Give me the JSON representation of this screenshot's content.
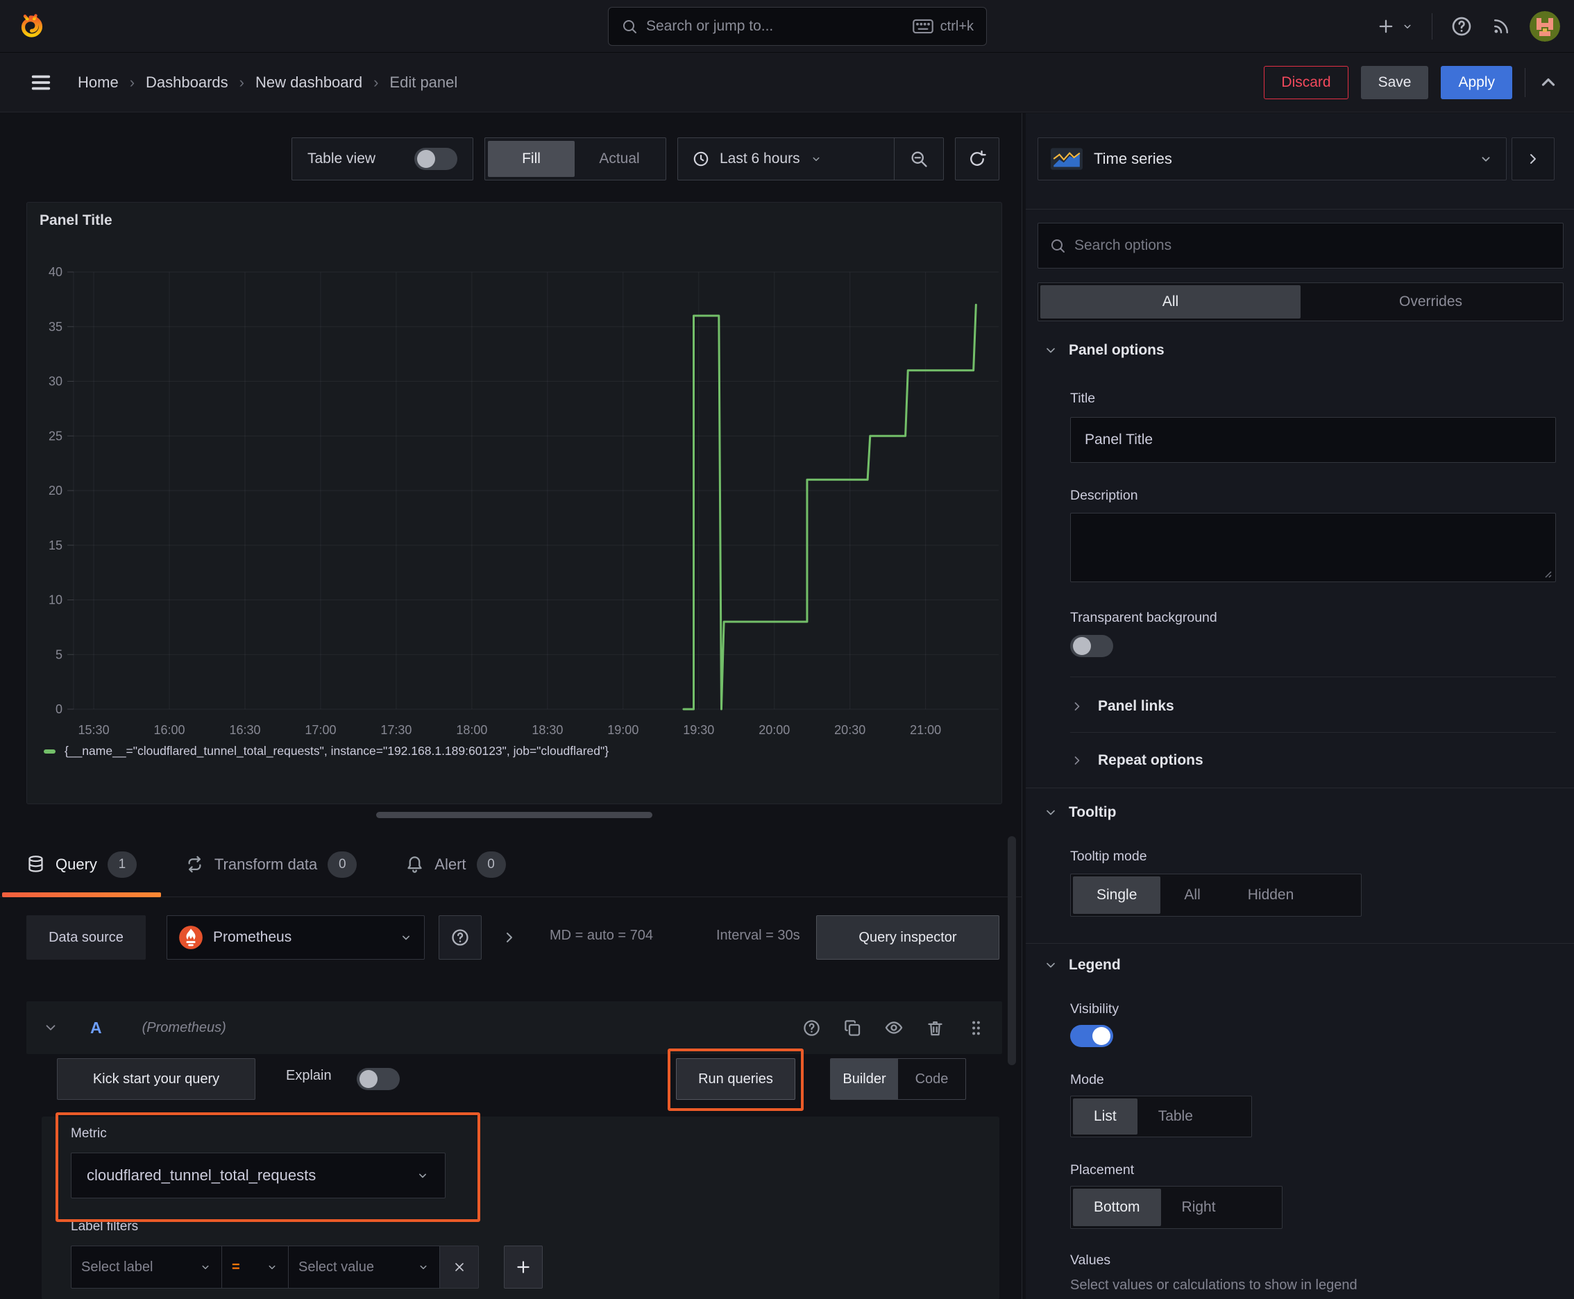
{
  "colors": {
    "background": "#111217",
    "panel_background": "#181b1f",
    "accent_orange": "#ff780a",
    "annotation_orange": "#eb5b28",
    "tab_underline_gradient": [
      "#f55f3e",
      "#ff8833"
    ],
    "series_green": "#73bf69",
    "primary_blue": "#3d71d9",
    "discard_red": "#f2495c",
    "ref_id_blue": "#6e9fff",
    "text": "#ccccdc"
  },
  "topbar": {
    "search_placeholder": "Search or jump to...",
    "search_shortcut": "ctrl+k"
  },
  "nav": {
    "breadcrumbs": [
      "Home",
      "Dashboards",
      "New dashboard",
      "Edit panel"
    ],
    "discard": "Discard",
    "save": "Save",
    "apply": "Apply"
  },
  "toolbar": {
    "table_view_label": "Table view",
    "fill": "Fill",
    "actual": "Actual",
    "time_range": "Last 6 hours"
  },
  "panel": {
    "title": "Panel Title",
    "legend_label": "{__name__=\"cloudflared_tunnel_total_requests\", instance=\"192.168.1.189:60123\", job=\"cloudflared\"}"
  },
  "chart_data": {
    "type": "line",
    "title": "Panel Title",
    "line_style": "stepped-counter",
    "series": [
      {
        "name": "{__name__=\"cloudflared_tunnel_total_requests\", instance=\"192.168.1.189:60123\", job=\"cloudflared\"}",
        "color": "#73bf69",
        "points": [
          [
            "19:24",
            0
          ],
          [
            "19:28",
            0
          ],
          [
            "19:28",
            36
          ],
          [
            "19:38",
            36
          ],
          [
            "19:39",
            0
          ],
          [
            "19:40",
            8
          ],
          [
            "20:13",
            8
          ],
          [
            "20:13",
            21
          ],
          [
            "20:37",
            21
          ],
          [
            "20:38",
            25
          ],
          [
            "20:52",
            25
          ],
          [
            "20:53",
            31
          ],
          [
            "21:19",
            31
          ],
          [
            "21:20",
            37
          ]
        ]
      }
    ],
    "x_ticks": [
      "15:30",
      "16:00",
      "16:30",
      "17:00",
      "17:30",
      "18:00",
      "18:30",
      "19:00",
      "19:30",
      "20:00",
      "20:30",
      "21:00"
    ],
    "x_range": [
      "15:22",
      "21:29"
    ],
    "y_ticks": [
      0,
      5,
      10,
      15,
      20,
      25,
      30,
      35,
      40
    ],
    "ylim": [
      0,
      40
    ],
    "xlabel": "",
    "ylabel": "",
    "grid": true,
    "legend_position": "bottom"
  },
  "tabs": {
    "query": "Query",
    "query_count": "1",
    "transform": "Transform data",
    "transform_count": "0",
    "alert": "Alert",
    "alert_count": "0"
  },
  "query": {
    "datasource_label": "Data source",
    "datasource_value": "Prometheus",
    "summary_md": "MD = auto = 704",
    "summary_interval": "Interval = 30s",
    "inspector": "Query inspector",
    "ref_id": "A",
    "ref_ds": "(Prometheus)",
    "kickstart": "Kick start your query",
    "explain": "Explain",
    "run_queries": "Run queries",
    "builder": "Builder",
    "code": "Code",
    "metric_label": "Metric",
    "metric_value": "cloudflared_tunnel_total_requests",
    "label_filters_label": "Label filters",
    "select_label_placeholder": "Select label",
    "operator": "=",
    "select_value_placeholder": "Select value"
  },
  "options": {
    "visualization": "Time series",
    "search_placeholder": "Search options",
    "tab_all": "All",
    "tab_overrides": "Overrides",
    "panel_options_header": "Panel options",
    "title_label": "Title",
    "title_value": "Panel Title",
    "description_label": "Description",
    "transparent_label": "Transparent background",
    "panel_links": "Panel links",
    "repeat_options": "Repeat options",
    "tooltip_header": "Tooltip",
    "tooltip_mode_label": "Tooltip mode",
    "tooltip_single": "Single",
    "tooltip_all": "All",
    "tooltip_hidden": "Hidden",
    "legend_header": "Legend",
    "visibility_label": "Visibility",
    "mode_label": "Mode",
    "mode_list": "List",
    "mode_table": "Table",
    "placement_label": "Placement",
    "placement_bottom": "Bottom",
    "placement_right": "Right",
    "values_label": "Values",
    "values_help": "Select values or calculations to show in legend"
  }
}
